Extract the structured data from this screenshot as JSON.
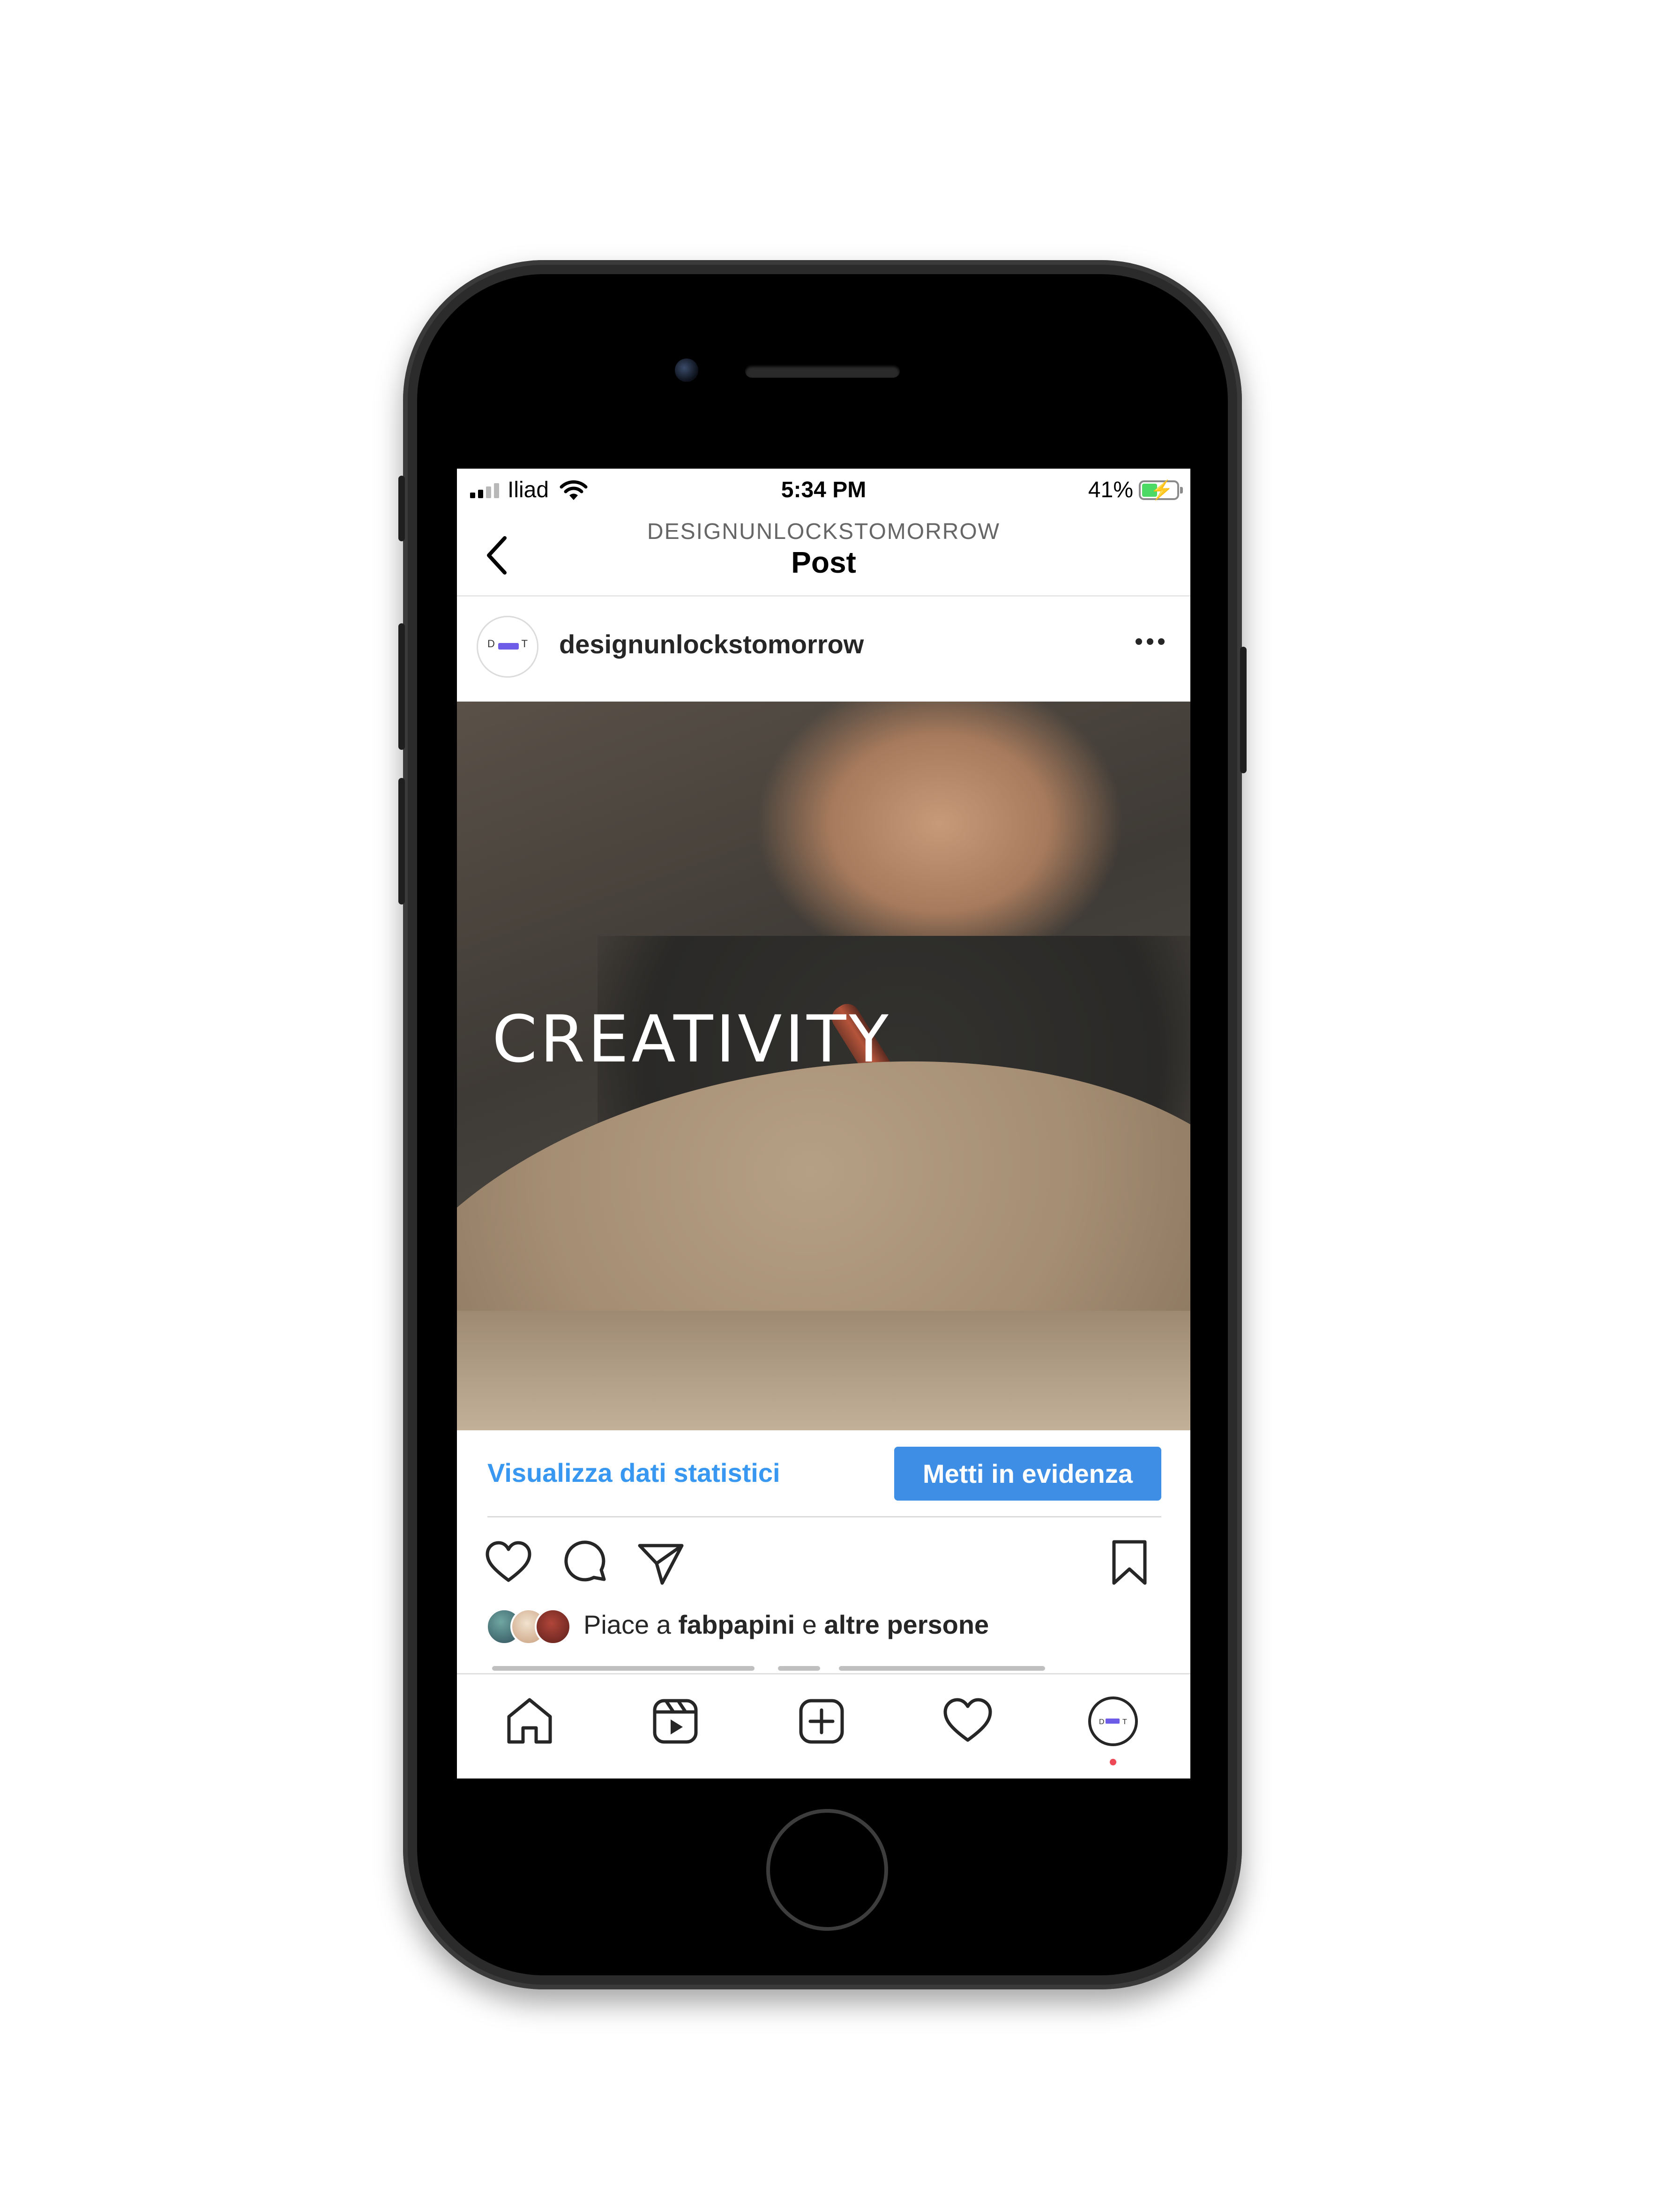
{
  "status_bar": {
    "carrier": "Iliad",
    "time": "5:34 PM",
    "battery_percent": "41%",
    "battery_level": 0.41,
    "icons": [
      "signal-icon",
      "wifi-icon",
      "battery-charging-icon"
    ]
  },
  "nav": {
    "subtitle": "DESIGNUNLOCKSTOMORROW",
    "title": "Post",
    "back_icon": "chevron-left-icon"
  },
  "post": {
    "username": "designunlockstomorrow",
    "avatar_letters": {
      "left": "D",
      "right": "T"
    },
    "avatar_accent": "#6c5ce7",
    "more_icon": "more-horizontal-icon",
    "media_text": "CREATIVITY",
    "insights_label": "Visualizza dati statistici",
    "promote_label": "Metti in evidenza",
    "accent_color": "#3897f0",
    "actions": [
      "heart-icon",
      "comment-icon",
      "share-icon",
      "bookmark-icon"
    ],
    "likes": {
      "prefix": "Piace a ",
      "user": "fabpapini",
      "middle": " e ",
      "others": "altre persone"
    }
  },
  "tab_bar": {
    "tabs": [
      "home-icon",
      "reels-icon",
      "create-icon",
      "activity-icon",
      "profile-icon"
    ],
    "notification_color": "#ed4956"
  }
}
